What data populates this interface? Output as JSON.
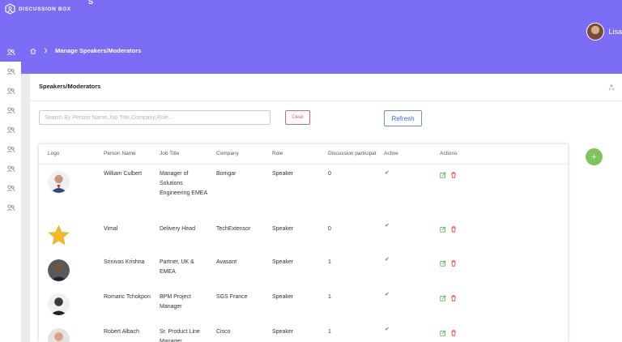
{
  "app": {
    "logo_text": "DISCUSSION BOX",
    "logo_mark": "S"
  },
  "user": {
    "name": "Lisa"
  },
  "breadcrumb": {
    "current": "Manage Speakers/Moderators"
  },
  "panel": {
    "title": "Speakers/Moderators"
  },
  "search": {
    "placeholder": "Search By Person Name,Job Title,Company,Role..."
  },
  "buttons": {
    "clear": "Clear",
    "refresh": "Refresh",
    "add": "+"
  },
  "table": {
    "headers": {
      "logo": "Logo",
      "person": "Person Name",
      "job": "Job Title",
      "company": "Company",
      "role": "Role",
      "discussion": "Discussion participation",
      "active": "Active",
      "actions": "Actions"
    },
    "rows": [
      {
        "name": "William Culbert",
        "job": "Manager of Solutions Engineering EMEA",
        "company": "Bomgar",
        "role": "Speaker",
        "discussion": "0",
        "active": "✔"
      },
      {
        "name": "Vimal",
        "job": "Delivery Head",
        "company": "TechExtensor",
        "role": "Speaker",
        "discussion": "0",
        "active": "✔"
      },
      {
        "name": "Srinivas Krishna",
        "job": "Partner, UK & EMEA",
        "company": "Avasant",
        "role": "Speaker",
        "discussion": "1",
        "active": "✔"
      },
      {
        "name": "Romaric Tchokpon",
        "job": "BPM Project Manager",
        "company": "SGS France",
        "role": "Speaker",
        "discussion": "1",
        "active": "✔"
      },
      {
        "name": "Robert Albach",
        "job": "Sr. Product Line Manager",
        "company": "Cisco",
        "role": "Speaker",
        "discussion": "1",
        "active": "✔"
      }
    ]
  },
  "colors": {
    "header": "#7b6df6",
    "add": "#7ec35c",
    "clear": "#e06666",
    "refresh": "#3a6fd8",
    "edit": "#4caf50",
    "delete": "#e53935"
  }
}
